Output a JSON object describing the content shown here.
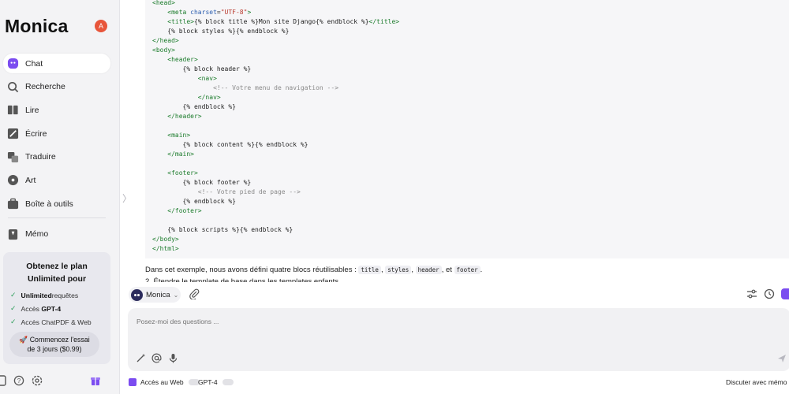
{
  "sidebar": {
    "brand": "Monica",
    "avatar_initial": "A",
    "items": [
      {
        "label": "Chat",
        "icon": "chat-bubble-icon",
        "active": true
      },
      {
        "label": "Recherche",
        "icon": "search-icon"
      },
      {
        "label": "Lire",
        "icon": "book-icon"
      },
      {
        "label": "Écrire",
        "icon": "pen-icon"
      },
      {
        "label": "Traduire",
        "icon": "translate-icon"
      },
      {
        "label": "Art",
        "icon": "palette-icon"
      },
      {
        "label": "Boîte à outils",
        "icon": "toolbox-icon"
      }
    ],
    "memo_label": "Mémo",
    "promo": {
      "title_line1": "Obtenez le plan",
      "title_line2": "Unlimited pour",
      "features": [
        {
          "bold": "Unlimited",
          "rest": " requêtes"
        },
        {
          "bold": "",
          "pre": "Accès ",
          "bold2": "GPT-4"
        },
        {
          "bold": "",
          "pre": "Accès ChatPDF & Web"
        }
      ],
      "cta_line1": "Commencez l'essai",
      "cta_line2": "de 3 jours ($0.99)"
    }
  },
  "code": {
    "lines": [
      [
        {
          "c": "tag",
          "t": "<head>"
        }
      ],
      [
        {
          "c": "pl",
          "t": "    "
        },
        {
          "c": "tag",
          "t": "<meta "
        },
        {
          "c": "attr",
          "t": "charset"
        },
        {
          "c": "pl",
          "t": "="
        },
        {
          "c": "str",
          "t": "\"UTF-8\""
        },
        {
          "c": "tag",
          "t": ">"
        }
      ],
      [
        {
          "c": "pl",
          "t": "    "
        },
        {
          "c": "tag",
          "t": "<title>"
        },
        {
          "c": "pl",
          "t": "{% block title %}Mon site Django{% endblock %}"
        },
        {
          "c": "tag",
          "t": "</title>"
        }
      ],
      [
        {
          "c": "pl",
          "t": "    {% block styles %}{% endblock %}"
        }
      ],
      [
        {
          "c": "tag",
          "t": "</head>"
        }
      ],
      [
        {
          "c": "tag",
          "t": "<body>"
        }
      ],
      [
        {
          "c": "pl",
          "t": "    "
        },
        {
          "c": "tag",
          "t": "<header>"
        }
      ],
      [
        {
          "c": "pl",
          "t": "        {% block header %}"
        }
      ],
      [
        {
          "c": "pl",
          "t": "            "
        },
        {
          "c": "tag",
          "t": "<nav>"
        }
      ],
      [
        {
          "c": "pl",
          "t": "                "
        },
        {
          "c": "cmt",
          "t": "<!-- Votre menu de navigation -->"
        }
      ],
      [
        {
          "c": "pl",
          "t": "            "
        },
        {
          "c": "tag",
          "t": "</nav>"
        }
      ],
      [
        {
          "c": "pl",
          "t": "        {% endblock %}"
        }
      ],
      [
        {
          "c": "pl",
          "t": "    "
        },
        {
          "c": "tag",
          "t": "</header>"
        }
      ],
      [
        {
          "c": "pl",
          "t": ""
        }
      ],
      [
        {
          "c": "pl",
          "t": "    "
        },
        {
          "c": "tag",
          "t": "<main>"
        }
      ],
      [
        {
          "c": "pl",
          "t": "        {% block content %}{% endblock %}"
        }
      ],
      [
        {
          "c": "pl",
          "t": "    "
        },
        {
          "c": "tag",
          "t": "</main>"
        }
      ],
      [
        {
          "c": "pl",
          "t": ""
        }
      ],
      [
        {
          "c": "pl",
          "t": "    "
        },
        {
          "c": "tag",
          "t": "<footer>"
        }
      ],
      [
        {
          "c": "pl",
          "t": "        {% block footer %}"
        }
      ],
      [
        {
          "c": "pl",
          "t": "            "
        },
        {
          "c": "cmt",
          "t": "<!-- Votre pied de page -->"
        }
      ],
      [
        {
          "c": "pl",
          "t": "        {% endblock %}"
        }
      ],
      [
        {
          "c": "pl",
          "t": "    "
        },
        {
          "c": "tag",
          "t": "</footer>"
        }
      ],
      [
        {
          "c": "pl",
          "t": ""
        }
      ],
      [
        {
          "c": "pl",
          "t": "    {% block scripts %}{% endblock %}"
        }
      ],
      [
        {
          "c": "tag",
          "t": "</body>"
        }
      ],
      [
        {
          "c": "tag",
          "t": "</html>"
        }
      ]
    ]
  },
  "message": {
    "text_before": "Dans cet exemple, nous avons défini quatre blocs réutilisables : ",
    "codes": [
      "title",
      "styles",
      "header",
      "footer"
    ],
    "sep1": ", ",
    "sep2": ", ",
    "sep3": ", et ",
    "end": ".",
    "next_line_partial": "2. Étendre le template de base dans les templates enfants"
  },
  "composer": {
    "model_name": "Monica",
    "placeholder": "Posez-moi des questions ...",
    "web_access_label": "Accès au Web",
    "gpt4_label": "GPT-4",
    "memo_chat_label": "Discuter avec mémo"
  },
  "colors": {
    "accent": "#7b4cf0",
    "avatar": "#e8553a",
    "check": "#2e9e5b"
  }
}
